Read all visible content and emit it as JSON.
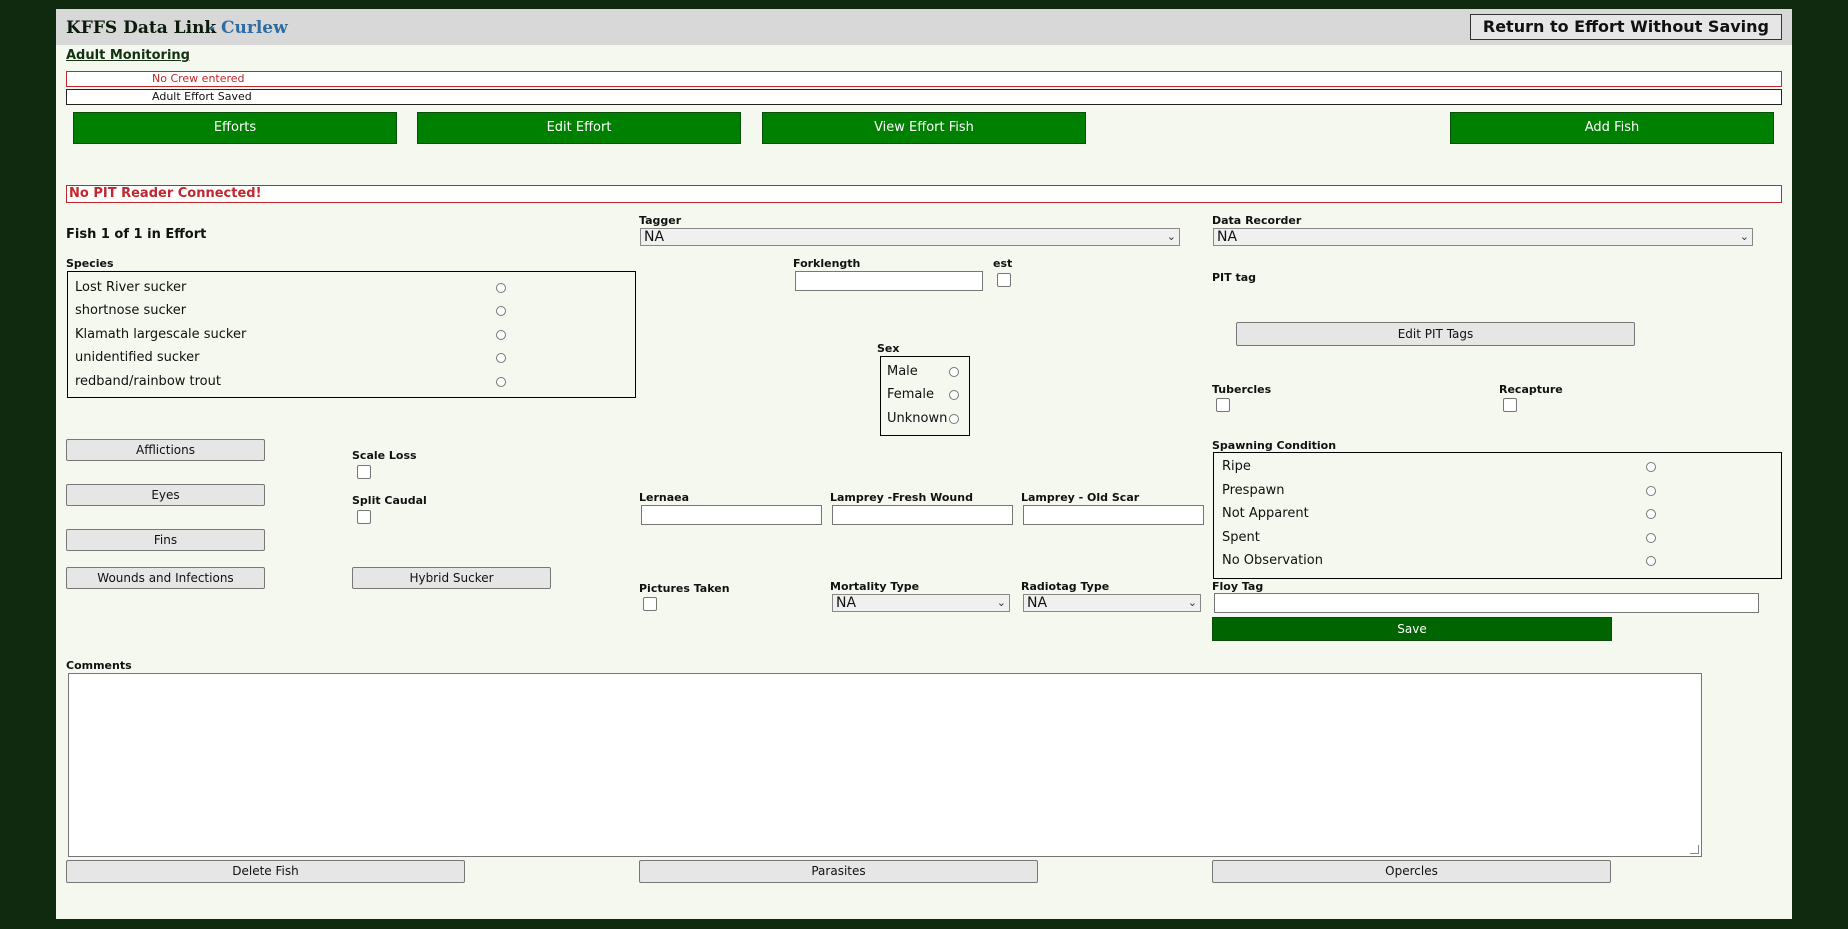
{
  "header": {
    "title": "KFFS Data Link",
    "subtitle": "- Curlew",
    "return_label": "Return to Effort Without Saving"
  },
  "nav": {
    "adult_monitoring": "Adult Monitoring"
  },
  "messages": {
    "error": "No Crew entered",
    "success": "Adult Effort Saved"
  },
  "actions": {
    "efforts": "Efforts",
    "edit_effort": "Edit Effort",
    "view_effort_fish": "View Effort Fish",
    "add_fish": "Add Fish"
  },
  "pit_alert": "No PIT Reader Connected!",
  "fish": {
    "counter": "Fish 1 of 1 in Effort",
    "species_label": "Species",
    "species": [
      "Lost River sucker",
      "shortnose sucker",
      "Klamath largescale sucker",
      "unidentified sucker",
      "redband/rainbow trout"
    ],
    "tagger_label": "Tagger",
    "tagger_value": "NA",
    "data_recorder_label": "Data Recorder",
    "data_recorder_value": "NA",
    "forklength_label": "Forklength",
    "est_label": "est",
    "pit_tag_label": "PIT tag",
    "edit_pit_tags": "Edit PIT Tags",
    "sex_label": "Sex",
    "sex_options": [
      "Male",
      "Female",
      "Unknown"
    ],
    "tubercles_label": "Tubercles",
    "recapture_label": "Recapture",
    "spawning_label": "Spawning Condition",
    "spawning_options": [
      "Ripe",
      "Prespawn",
      "Not Apparent",
      "Spent",
      "No Observation"
    ],
    "afflictions": "Afflictions",
    "eyes": "Eyes",
    "fins": "Fins",
    "wounds": "Wounds and Infections",
    "scale_loss_label": "Scale Loss",
    "split_caudal_label": "Split Caudal",
    "hybrid_sucker": "Hybrid Sucker",
    "lernaea_label": "Lernaea",
    "lamprey_fresh_label": "Lamprey -Fresh Wound",
    "lamprey_old_label": "Lamprey - Old Scar",
    "pictures_label": "Pictures Taken",
    "mortality_label": "Mortality Type",
    "mortality_value": "NA",
    "radiotag_label": "Radiotag Type",
    "radiotag_value": "NA",
    "floy_label": "Floy Tag",
    "save": "Save",
    "comments_label": "Comments",
    "delete_fish": "Delete Fish",
    "parasites": "Parasites",
    "opercles": "Opercles"
  }
}
